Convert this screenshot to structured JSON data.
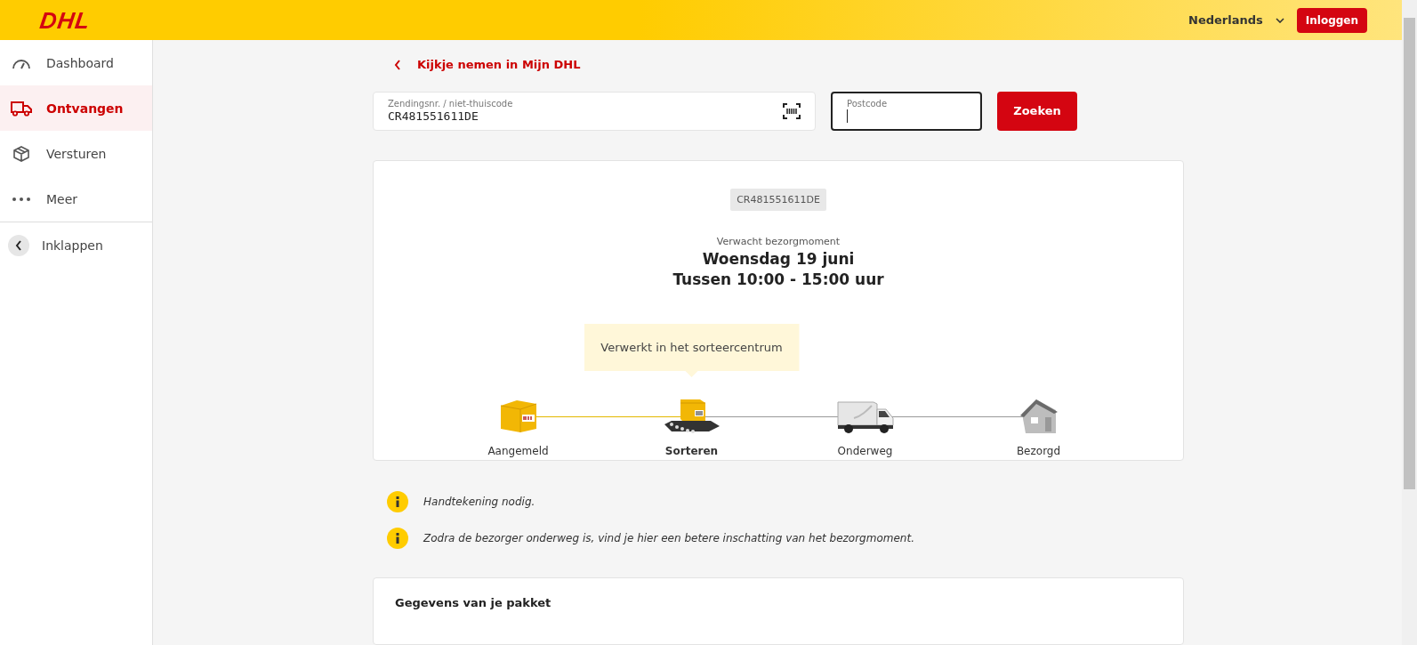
{
  "header": {
    "logo": "DHL",
    "language": "Nederlands",
    "login_button": "Inloggen"
  },
  "sidebar": {
    "items": [
      {
        "label": "Dashboard",
        "kind": "gauge",
        "selected": false
      },
      {
        "label": "Ontvangen",
        "kind": "truck",
        "selected": true
      },
      {
        "label": "Versturen",
        "kind": "box",
        "selected": false
      },
      {
        "label": "Meer",
        "kind": "dots",
        "selected": false
      }
    ],
    "collapse": "Inklappen"
  },
  "back_link": "Kijkje nemen in Mijn DHL",
  "search": {
    "shipment_label": "Zendingsnr. / niet-thuiscode",
    "shipment_value": "CR481551611DE",
    "postcode_label": "Postcode",
    "button": "Zoeken"
  },
  "tracking": {
    "code": "CR481551611DE",
    "expected_label": "Verwacht bezorgmoment",
    "date": "Woensdag 19 juni",
    "time": "Tussen 10:00 - 15:00 uur",
    "status_tooltip": "Verwerkt in het sorteercentrum",
    "steps": [
      {
        "label": "Aangemeld",
        "kind": "parcel",
        "reached": true,
        "selected": false
      },
      {
        "label": "Sorteren",
        "kind": "sorting",
        "reached": true,
        "selected": true
      },
      {
        "label": "Onderweg",
        "kind": "van",
        "reached": false,
        "selected": false
      },
      {
        "label": "Bezorgd",
        "kind": "house",
        "reached": false,
        "selected": false
      }
    ]
  },
  "notices": [
    "Handtekening nodig.",
    "Zodra de bezorger onderweg is, vind je hier een betere inschatting van het bezorgmoment."
  ],
  "details_card": {
    "title": "Gegevens van je pakket"
  }
}
